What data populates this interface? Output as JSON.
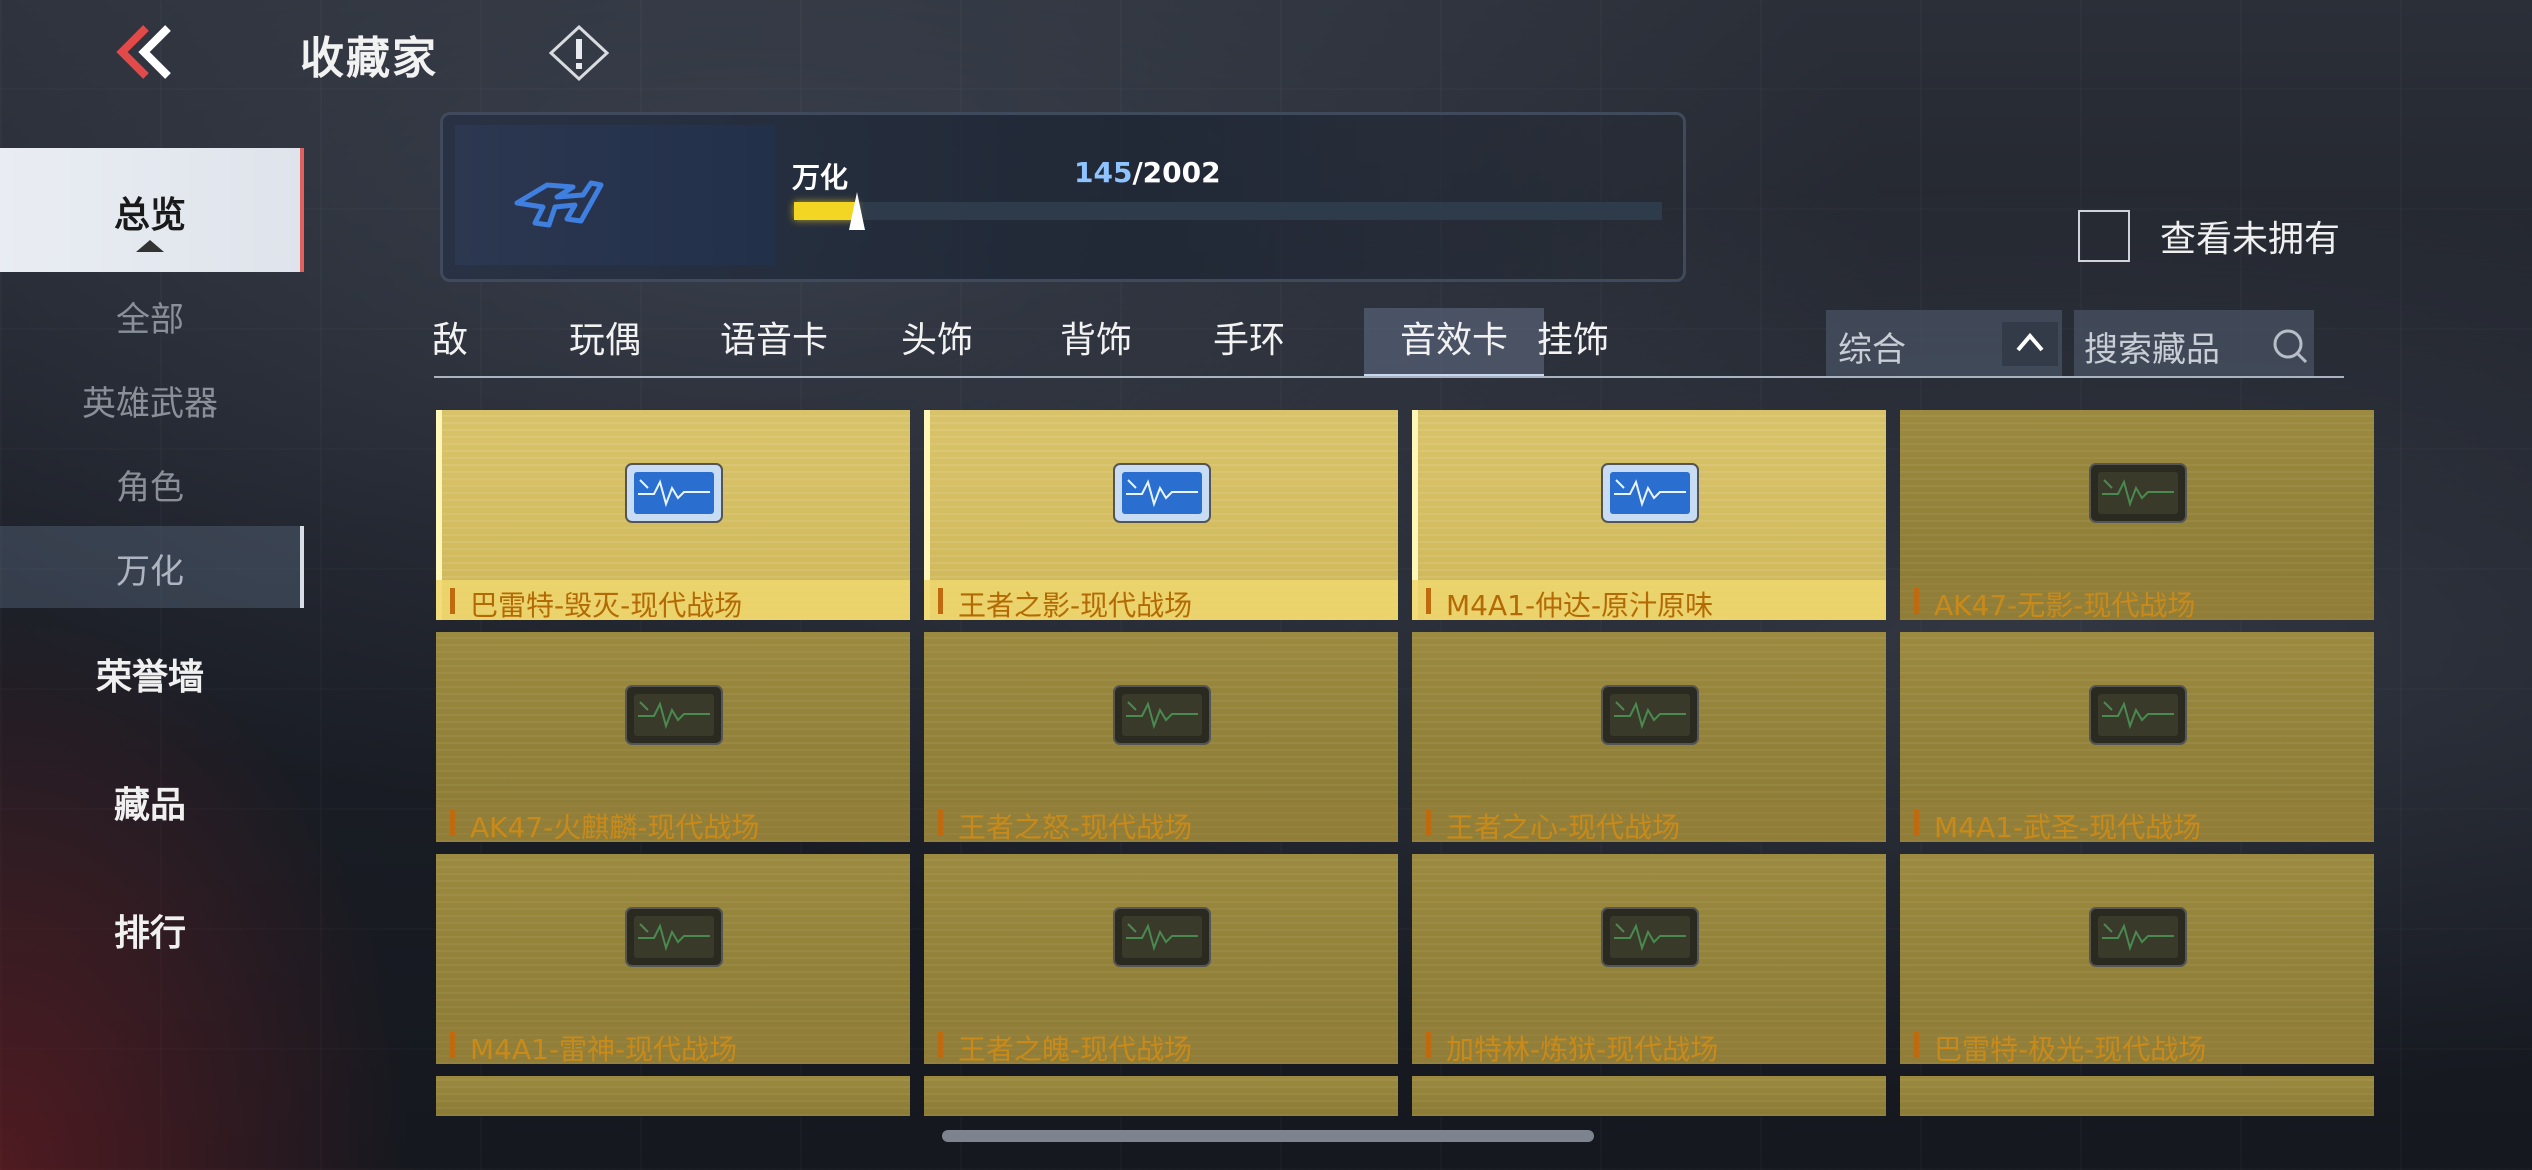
{
  "header": {
    "title": "收藏家"
  },
  "nav": {
    "overview": "总览",
    "sub_items": [
      "全部",
      "英雄武器",
      "角色",
      "万化"
    ],
    "active_sub": "万化",
    "honor_wall": "荣誉墙",
    "collectibles": "藏品",
    "ranking": "排行"
  },
  "progress": {
    "label": "万化",
    "current": "145",
    "total": "/2002",
    "fraction": 0.0724
  },
  "filter": {
    "unowned_label": "查看未拥有"
  },
  "tabs": [
    "敌",
    "玩偶",
    "语音卡",
    "头饰",
    "背饰",
    "手环",
    "音效卡",
    "挂饰"
  ],
  "active_tab": "音效卡",
  "sort": {
    "label": "综合"
  },
  "search": {
    "placeholder": "搜索藏品"
  },
  "items": [
    {
      "name": "巴雷特-毁灭-现代战场",
      "owned": true
    },
    {
      "name": "王者之影-现代战场",
      "owned": true
    },
    {
      "name": "M4A1-仲达-原汁原味",
      "owned": true
    },
    {
      "name": "AK47-无影-现代战场",
      "owned": false
    },
    {
      "name": "AK47-火麒麟-现代战场",
      "owned": false
    },
    {
      "name": "王者之怒-现代战场",
      "owned": false
    },
    {
      "name": "王者之心-现代战场",
      "owned": false
    },
    {
      "name": "M4A1-武圣-现代战场",
      "owned": false
    },
    {
      "name": "M4A1-雷神-现代战场",
      "owned": false
    },
    {
      "name": "王者之魄-现代战场",
      "owned": false
    },
    {
      "name": "加特林-炼狱-现代战场",
      "owned": false
    },
    {
      "name": "巴雷特-极光-现代战场",
      "owned": false
    },
    {
      "name": "",
      "owned": false
    },
    {
      "name": "",
      "owned": false
    },
    {
      "name": "",
      "owned": false
    },
    {
      "name": "",
      "owned": false
    }
  ],
  "colors": {
    "accent_yellow": "#f3d623",
    "progress_current": "#8ec3ff",
    "item_name": "#c98a1a"
  }
}
